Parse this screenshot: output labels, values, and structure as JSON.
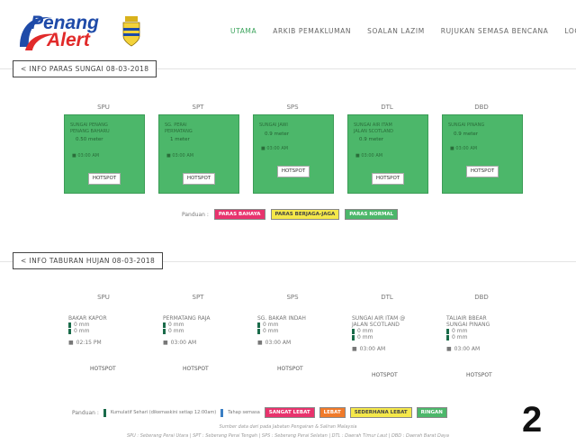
{
  "logo": {
    "line1": "Penang",
    "line2": "Alert"
  },
  "nav": [
    {
      "label": "UTAMA",
      "active": true
    },
    {
      "label": "ARKIB PEMAKLUMAN",
      "active": false
    },
    {
      "label": "SOALAN LAZIM",
      "active": false
    },
    {
      "label": "RUJUKAN SEMASA BENCANA",
      "active": false
    },
    {
      "label": "LOGIN",
      "active": false
    }
  ],
  "river": {
    "title": "INFO PARAS SUNGAI 08-03-2018",
    "stations": [
      {
        "code": "SPU",
        "name": "SUNGAI PENANG",
        "subname": "PENANG BAHARU",
        "value": "0.50 meter",
        "time": "03:00 AM",
        "hotspot": "HOTSPOT"
      },
      {
        "code": "SPT",
        "name": "SG. PERAI",
        "subname": "PERMATANG",
        "value": "1 meter",
        "time": "03:00 AM",
        "hotspot": "HOTSPOT"
      },
      {
        "code": "SPS",
        "name": "SUNGAI JAWI",
        "subname": "",
        "value": "0.9 meter",
        "time": "03:00 AM",
        "hotspot": "HOTSPOT"
      },
      {
        "code": "DTL",
        "name": "SUNGAI AIR ITAM",
        "subname": "JALAN SCOTLAND",
        "value": "0.9 meter",
        "time": "03:00 AM",
        "hotspot": "HOTSPOT"
      },
      {
        "code": "DBD",
        "name": "SUNGAI PINANG",
        "subname": "",
        "value": "0.9 meter",
        "time": "03:00 AM",
        "hotspot": "HOTSPOT"
      }
    ],
    "legend_label": "Panduan :",
    "legend": [
      {
        "label": "PARAS BAHAYA",
        "color": "#e8336d",
        "text_color": "#ffffff"
      },
      {
        "label": "PARAS BERJAGA-JAGA",
        "color": "#f5e84a",
        "text_color": "#444444"
      },
      {
        "label": "PARAS NORMAL",
        "color": "#4cb76a",
        "text_color": "#ffffff"
      }
    ]
  },
  "rain": {
    "title": "INFO TABURAN HUJAN 08-03-2018",
    "stations": [
      {
        "code": "SPU",
        "name": "BAKAR KAPOR",
        "name2": "",
        "v1": "0 mm",
        "v2": "0 mm",
        "time": "02:15 PM",
        "hotspot": "HOTSPOT"
      },
      {
        "code": "SPT",
        "name": "PERMATANG RAJA",
        "name2": "",
        "v1": "0 mm",
        "v2": "0 mm",
        "time": "03:00 AM",
        "hotspot": "HOTSPOT"
      },
      {
        "code": "SPS",
        "name": "SG. BAKAR INDAH",
        "name2": "",
        "v1": "0 mm",
        "v2": "0 mm",
        "time": "03:00 AM",
        "hotspot": "HOTSPOT"
      },
      {
        "code": "DTL",
        "name": "SUNGAI AIR ITAM @",
        "name2": "JALAN SCOTLAND",
        "v1": "0 mm",
        "v2": "0 mm",
        "time": "03:00 AM",
        "hotspot": "HOTSPOT"
      },
      {
        "code": "DBD",
        "name": "TALIAIR BBEAR",
        "name2": "SUNGAI PINANG",
        "v1": "0 mm",
        "v2": "0 mm",
        "time": "03:00 AM",
        "hotspot": "HOTSPOT"
      }
    ],
    "legend_label": "Panduan :",
    "legend_item1": "Kumulatif Sehari (dikemaskini setiap 12:00am)",
    "legend_item2": "Tahap semasa",
    "legend": [
      {
        "label": "SANGAT LEBAT",
        "color": "#e8336d",
        "text_color": "#ffffff"
      },
      {
        "label": "LEBAT",
        "color": "#f07a2a",
        "text_color": "#ffffff"
      },
      {
        "label": "SEDERHANA LEBAT",
        "color": "#f5e84a",
        "text_color": "#444444"
      },
      {
        "label": "RINGAN",
        "color": "#4cb76a",
        "text_color": "#ffffff"
      }
    ]
  },
  "footer": {
    "line1": "Sumber data dari pada Jabatan Pengairan & Saliran Malaysia",
    "line2": "SPU : Seberang Perai Utara | SPT : Seberang Perai Tengah | SPS : Seberang Perai Selatan | DTL : Daerah Timur Laut | DBD : Daerah Barat Daya"
  },
  "corner_number": "2"
}
